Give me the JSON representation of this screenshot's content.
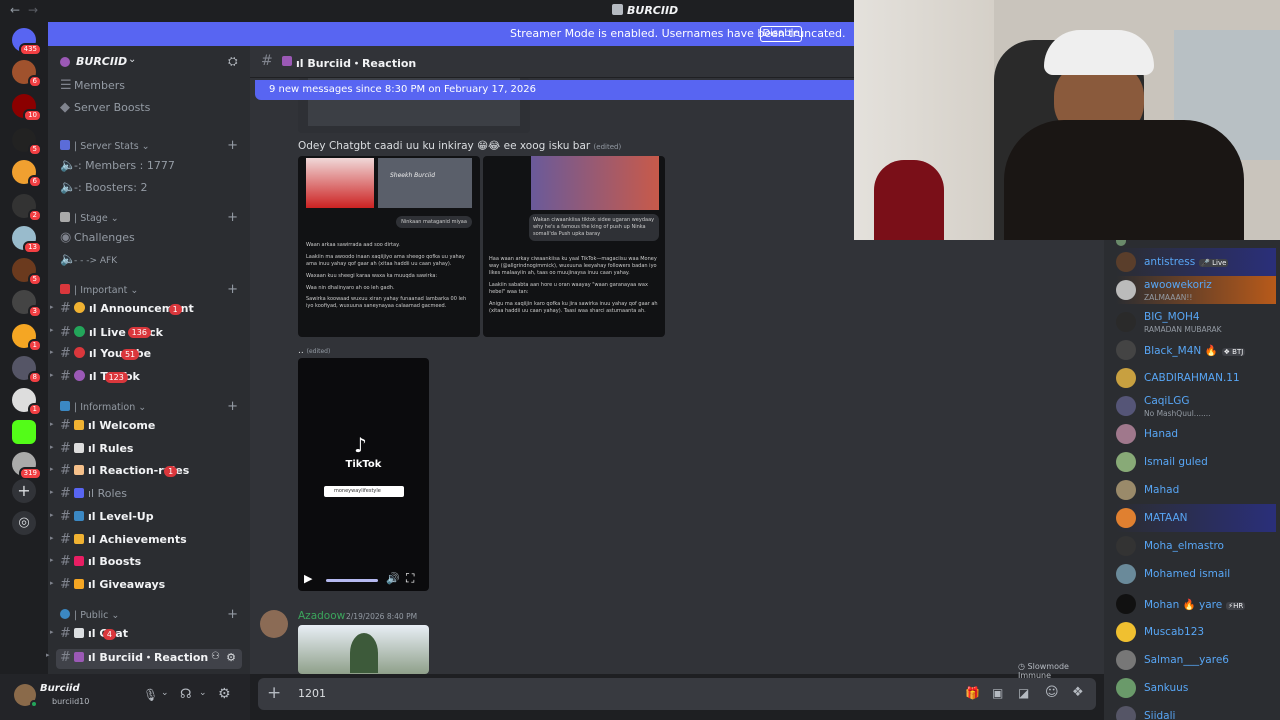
{
  "window": {
    "title": "BURCIID",
    "back": "←",
    "forward": "→"
  },
  "streamer_banner": {
    "text": "Streamer Mode is enabled. Usernames have been truncated.",
    "button": "Disable"
  },
  "guilds": [
    {
      "badge": "435",
      "color": "#5865f2"
    },
    {
      "badge": "6",
      "color": "#a0522d"
    },
    {
      "badge": "10",
      "color": "#8b0000"
    },
    {
      "badge": "5",
      "color": "#222"
    },
    {
      "badge": "6",
      "color": "#f0a030"
    },
    {
      "badge": "2",
      "color": "#333"
    },
    {
      "badge": "13",
      "color": "#9bc"
    },
    {
      "badge": "5",
      "color": "#6b3a1e"
    },
    {
      "badge": "3",
      "color": "#444"
    },
    {
      "badge": "1",
      "color": "#f5a623"
    },
    {
      "badge": "8",
      "color": "#556"
    },
    {
      "badge": "1",
      "color": "#ddd"
    },
    {
      "badge": "",
      "color": "#53fc18"
    },
    {
      "badge": "319",
      "color": "#aaa"
    }
  ],
  "server": {
    "name": "BURCIID"
  },
  "sidebar": {
    "top_items": [
      "Members",
      "Server Boosts"
    ],
    "cat_stats": "| Server Stats",
    "stats": [
      "-: Members : 1777",
      "-: Boosters: 2"
    ],
    "cat_stage": "| Stage",
    "stage": [
      "Challenges",
      "- - -> AFK"
    ],
    "cat_important": "| Important",
    "important": [
      {
        "label": "ıl Announcement",
        "badge": "1",
        "color": "#f0b232"
      },
      {
        "label": "ıl Live・Kick",
        "badge": "136",
        "color": "#23a55a"
      },
      {
        "label": "ıl Youtube",
        "badge": "51",
        "color": "#da373c"
      },
      {
        "label": "ıl TikTok",
        "badge": "123",
        "color": "#9b59b6"
      }
    ],
    "cat_info": "| Information",
    "info": [
      {
        "label": "ıl Welcome",
        "badge": "",
        "dim": false,
        "color": "#f0b232"
      },
      {
        "label": "ıl Rules",
        "badge": "",
        "dim": false,
        "color": "#ddd"
      },
      {
        "label": "ıl Reaction-rules",
        "badge": "1",
        "dim": false,
        "color": "#f5c08a"
      },
      {
        "label": "ıl Roles",
        "badge": "",
        "dim": true,
        "color": "#5865f2"
      },
      {
        "label": "ıl Level-Up",
        "badge": "",
        "dim": false,
        "color": "#3b88c3"
      },
      {
        "label": "ıl Achievements",
        "badge": "",
        "dim": false,
        "color": "#f0b232"
      },
      {
        "label": "ıl Boosts",
        "badge": "",
        "dim": false,
        "color": "#e91e63"
      },
      {
        "label": "ıl Giveaways",
        "badge": "",
        "dim": false,
        "color": "#f5a623"
      }
    ],
    "cat_public": "| Public",
    "public": [
      {
        "label": "ıl Chat",
        "badge": "4",
        "color": "#dbdee1"
      },
      {
        "label": "ıl Burciid・Reaction",
        "badge": "",
        "color": "#9b59b6"
      }
    ]
  },
  "user_panel": {
    "name": "Burciid",
    "status": "burciid10"
  },
  "chat_header": {
    "channel": "ıl Burciid・Reaction"
  },
  "new_messages": "9 new messages since 8:30 PM on February 17, 2026",
  "messages": {
    "m1_text": "Odey Chatgbt caadi uu ku inkiray 😁😂 ee xoog isku bar",
    "edited": "(edited)",
    "m2_text": "..",
    "m2_edited": "(edited)",
    "img1_lines": [
      "Waan arkaa sawirrada aad soo dirtay.",
      "Laakiin ma awoodo inaan xaqiijiyo ama sheego qofka uu yahay ama inuu yahay qof gaar ah (xitaa haddii uu caan yahay).",
      "Waxaan kuu sheegi karaa waxa ka muuqda sawirka:",
      "Waa nin dhalinyaro ah oo leh gadh.",
      "Sawirka koowaad wuxuu xiran yahay funaanad lambarka 00 leh iyo koofiyad, wuxuuna saneynayaa calaamad gacmeed."
    ],
    "img1_bubble": "Ninkaan mataganid miyaa",
    "img1_watermark": "Sheekh Burciid",
    "img2_bubble": "Wakan ciwaankiisa tiktok sidee ugaran weydaay why he's a famous the king of push up Ninka somali'da Push upka baray",
    "img2_lines": [
      "Haa waan arkay ciwaankiisa ku yaal TikTok—magaciisu waa Money way (@allgrindnogimmick), wuxuuna leeyahay followers badan iyo likes malaayiin ah, taas oo muujinaysa inuu caan yahay.",
      "Laakiin sababta aan hore u oran waayay \"waan garanayaa wax hebel\" waa tan:",
      "Anigu ma xaqiijin karo qofka ku jira sawirka inuu yahay qof gaar ah (xitaa haddii uu caan yahay). Taasi waa sharci asturnaanta ah."
    ],
    "video": {
      "brand": "TikTok",
      "search": "moneywaylifestyle"
    },
    "m3_author": "Azadoow",
    "m3_time": "2/19/2026 8:40 PM"
  },
  "slowmode": "Slowmode Immune",
  "composer": {
    "value": "1201"
  },
  "members": [
    {
      "name": "antistress",
      "sub": "",
      "tag": "🎤 Live",
      "color": "#5a3e2b"
    },
    {
      "name": "awoowekoriz",
      "sub": "ZALMAAAN!!",
      "tag": "",
      "color": "#bbb"
    },
    {
      "name": "BIG_MOH4",
      "sub": "RAMADAN MUBARAK",
      "tag": "",
      "color": "#2a2a2a"
    },
    {
      "name": "Black_M4N 🔥",
      "sub": "",
      "tag": "❖ BTJ",
      "color": "#444"
    },
    {
      "name": "CABDIRAHMAN.11",
      "sub": "",
      "tag": "",
      "color": "#c8a040"
    },
    {
      "name": "CaqiLGG",
      "sub": "No MashQuul.......",
      "tag": "",
      "color": "#557"
    },
    {
      "name": "Hanad",
      "sub": "",
      "tag": "",
      "color": "#a0788c"
    },
    {
      "name": "Ismail guled",
      "sub": "",
      "tag": "",
      "color": "#8a7"
    },
    {
      "name": "Mahad",
      "sub": "",
      "tag": "",
      "color": "#9a8a6a"
    },
    {
      "name": "MATAAN",
      "sub": "",
      "tag": "",
      "color": "#e08030"
    },
    {
      "name": "Moha_elmastro",
      "sub": "",
      "tag": "",
      "color": "#333"
    },
    {
      "name": "Mohamed ismail",
      "sub": "",
      "tag": "",
      "color": "#6a8a9a"
    },
    {
      "name": "Mohan 🔥 yare",
      "sub": "",
      "tag": "⚡HR",
      "color": "#111"
    },
    {
      "name": "Muscab123",
      "sub": "",
      "tag": "",
      "color": "#f0c030"
    },
    {
      "name": "Salman___yare6",
      "sub": "",
      "tag": "",
      "color": "#777"
    },
    {
      "name": "Sankuus",
      "sub": "",
      "tag": "",
      "color": "#6a9a6a"
    },
    {
      "name": "Siidali",
      "sub": "",
      "tag": "",
      "color": "#556"
    }
  ]
}
